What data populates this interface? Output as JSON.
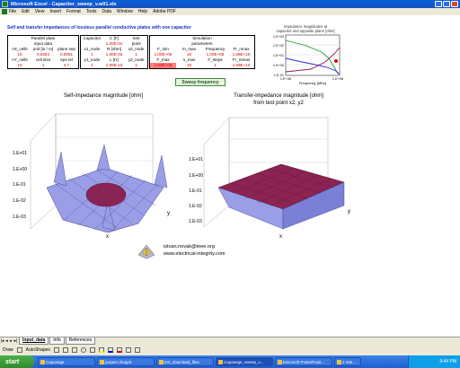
{
  "window": {
    "title": "Microsoft Excel - Capacitor_sweep_v.w01.xls"
  },
  "menu": [
    "File",
    "Edit",
    "View",
    "Insert",
    "Format",
    "Tools",
    "Data",
    "Window",
    "Help",
    "Adobe PDF"
  ],
  "sheet_title": "Self and transfer impedances of lossless parallel conductive plates with one capacitor",
  "tables": {
    "plane": {
      "header1": "Parallel plate",
      "header2": "input data",
      "cols": [
        "nX_cells",
        "unit [in / m]",
        "plane sep"
      ],
      "vals": [
        "10",
        "0.0254",
        "0.0001"
      ],
      "cols2": [
        "nY_cells",
        "cell size",
        "eps rel"
      ],
      "vals2": [
        "10",
        "1",
        "4.7"
      ]
    },
    "capacitor": {
      "cols": [
        "Capacitor",
        "C [F]",
        "test"
      ],
      "sub": [
        "",
        "1.00E-01",
        "point"
      ],
      "cols2": [
        "x1_node",
        "R [ohm]",
        "x2_node"
      ],
      "vals2": [
        "1",
        "1.00E-03",
        "1"
      ],
      "cols3": [
        "y1_node",
        "L [H]",
        "y2_node"
      ],
      "vals3": [
        "1",
        "1.00E-10",
        "1"
      ]
    },
    "simulation": {
      "header1": "Simulation",
      "header2": "parameters",
      "cols": [
        "F_min",
        "m_max",
        "Frequency",
        "Fr_nmax"
      ],
      "vals": [
        "1.00E+06",
        "10",
        "1.00E+08",
        "1.59E+10"
      ],
      "cols2": [
        "F_max",
        "n_max",
        "F_steps",
        "Fr_mmax"
      ],
      "vals2": [
        "1.00E+09",
        "10",
        "1",
        "1.59E+10"
      ]
    }
  },
  "sweep_button": "Sweep frequency",
  "mini_chart": {
    "title1": "Impedance magnitudes at",
    "title2": "capacitor and opposite plane [ohm]",
    "xlabel": "Frequency [MHz]",
    "yticks": [
      "1.E+03",
      "1.E+02",
      "1.E+01",
      "1.E+00",
      "1.E-01"
    ],
    "xticks": [
      "1.E+06",
      "1.E+08"
    ]
  },
  "plots": {
    "left_title": "Self-impedance magnitude [ohm]",
    "right_title_1": "Transfer-impedance magnitude [ohm]",
    "right_title_2": "from test point x2, y2",
    "zticks_left": [
      "1.E+01",
      "1.E+00",
      "1.E-01",
      "1.E-02",
      "1.E-03"
    ],
    "zticks_right": [
      "1.E+01",
      "1.E+00",
      "1.E-01",
      "1.E-02",
      "1.E-03"
    ],
    "axis_x": "x",
    "axis_y": "y"
  },
  "credit": {
    "email": "istvan.novak@ieee.org",
    "site": "www.electrical-integrity.com"
  },
  "tabs": [
    "Input_data",
    "Info",
    "References"
  ],
  "drawbar": {
    "draw": "Draw",
    "autoshapes": "AutoShapes"
  },
  "taskbar": {
    "start": "start",
    "tasks": [
      "Capasege",
      "purpen droppit",
      "Ext_downlead_files",
      "Capasege_sweep_v...",
      "Microsoft PowerPoint...",
      "2 Inte..."
    ],
    "clock": "9:44 PM"
  },
  "colors": {
    "accent": "#1e30c8",
    "surface": "#9a9ee6",
    "top": "#8b2452"
  }
}
